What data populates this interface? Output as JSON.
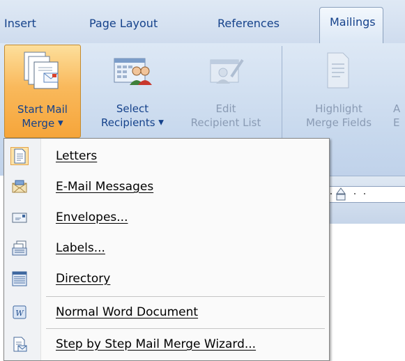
{
  "tabs": [
    {
      "label": "Insert",
      "active": false
    },
    {
      "label": "Page Layout",
      "active": false
    },
    {
      "label": "References",
      "active": false
    },
    {
      "label": "Mailings",
      "active": true
    }
  ],
  "ribbon": {
    "start_mail_merge": {
      "line1": "Start Mail",
      "line2": "Merge",
      "icon": "start-mail-merge-icon"
    },
    "select_recipients": {
      "line1": "Select",
      "line2": "Recipients",
      "icon": "select-recipients-icon"
    },
    "edit_recipient_list": {
      "line1": "Edit",
      "line2": "Recipient List",
      "icon": "edit-recipient-list-icon"
    },
    "highlight_merge_fields": {
      "line1": "Highlight",
      "line2": "Merge Fields",
      "icon": "highlight-merge-fields-icon"
    },
    "cut_next": {
      "line1": "A",
      "line2": "E"
    }
  },
  "menu": {
    "items": [
      {
        "label": "Letters",
        "icon": "letters-icon"
      },
      {
        "label": "E-Mail Messages",
        "icon": "email-messages-icon"
      },
      {
        "label": "Envelopes...",
        "icon": "envelopes-icon"
      },
      {
        "label": "Labels...",
        "icon": "labels-icon"
      },
      {
        "label": "Directory",
        "icon": "directory-icon"
      },
      {
        "label": "Normal Word Document",
        "icon": "normal-word-document-icon"
      },
      {
        "label": "Step by Step Mail Merge Wizard...",
        "icon": "mail-merge-wizard-icon"
      }
    ]
  },
  "colors": {
    "accent": "#f6a53a",
    "ribbon_text": "#15428b",
    "disabled_text": "#8a9bb4"
  }
}
